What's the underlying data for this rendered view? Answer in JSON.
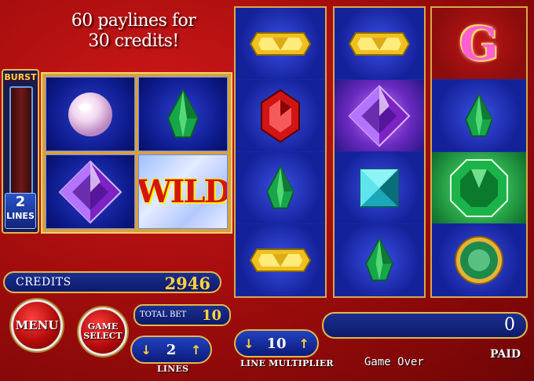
{
  "promo": {
    "line1": "60 paylines for",
    "line2": "30 credits!"
  },
  "burst": {
    "label": "BURST",
    "lines_value": "2",
    "lines_label": "LINES"
  },
  "mini_reels": [
    {
      "symbol": "pearl-icon"
    },
    {
      "symbol": "emerald-teardrop-icon"
    },
    {
      "symbol": "amethyst-diamond-icon"
    },
    {
      "symbol": "wild-icon",
      "text": "WILD"
    }
  ],
  "reels": [
    [
      "gold-bar-icon",
      "ruby-icon",
      "emerald-teardrop-icon",
      "gold-bar-icon"
    ],
    [
      "gold-bar-icon",
      "amethyst-diamond-icon",
      "aquamarine-square-icon",
      "emerald-teardrop-icon"
    ],
    [
      "g-letter-icon",
      "emerald-teardrop-icon",
      "emerald-octagon-icon",
      "emerald-round-icon"
    ]
  ],
  "g_letter": "G",
  "credits": {
    "label": "CREDITS",
    "value": "2946"
  },
  "buttons": {
    "menu": "MENU",
    "game_select_line1": "GAME",
    "game_select_line2": "SELECT"
  },
  "total_bet": {
    "label": "TOTAL BET",
    "value": "10"
  },
  "lines": {
    "value": "2",
    "label": "LINES"
  },
  "line_multiplier": {
    "value": "10",
    "label": "LINE MULTIPLIER"
  },
  "paid": {
    "value": "0",
    "label": "PAID"
  },
  "status": "Game Over",
  "colors": {
    "accent_gold": "#e2b84a",
    "reel_blue": "#0b1e99",
    "background_red": "#a50d0d",
    "value_yellow": "#ffd43a"
  }
}
